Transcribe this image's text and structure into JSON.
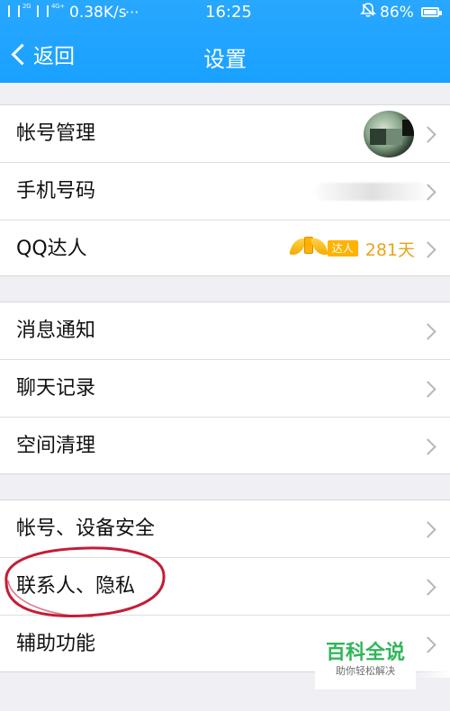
{
  "status_bar": {
    "signal1": "2G",
    "signal2": "4G+",
    "network_speed": "0.38K/s",
    "more": "···",
    "time": "16:25",
    "battery_percent": "86%",
    "icons": [
      "signal-bars-icon",
      "dual-network-icon",
      "alarm-off-icon",
      "battery-icon"
    ]
  },
  "nav": {
    "back_label": "返回",
    "title": "设置"
  },
  "groups": [
    {
      "items": [
        {
          "label": "帐号管理",
          "accessory": "avatar"
        },
        {
          "label": "手机号码",
          "accessory": "blurred-phone"
        },
        {
          "label": "QQ达人",
          "accessory": "badge",
          "badge_text": "达人",
          "days": "281天"
        }
      ]
    },
    {
      "items": [
        {
          "label": "消息通知"
        },
        {
          "label": "聊天记录"
        },
        {
          "label": "空间清理"
        }
      ]
    },
    {
      "items": [
        {
          "label": "帐号、设备安全"
        },
        {
          "label": "联系人、隐私"
        },
        {
          "label": "辅助功能"
        }
      ]
    }
  ],
  "watermark": {
    "main": "百科全说",
    "sub": "助你轻松解决"
  },
  "colors": {
    "header": "#1fa3ff",
    "background": "#efeff4",
    "badge": "#ffb300",
    "annotation": "#c41d36",
    "watermark": "#31b65a"
  }
}
